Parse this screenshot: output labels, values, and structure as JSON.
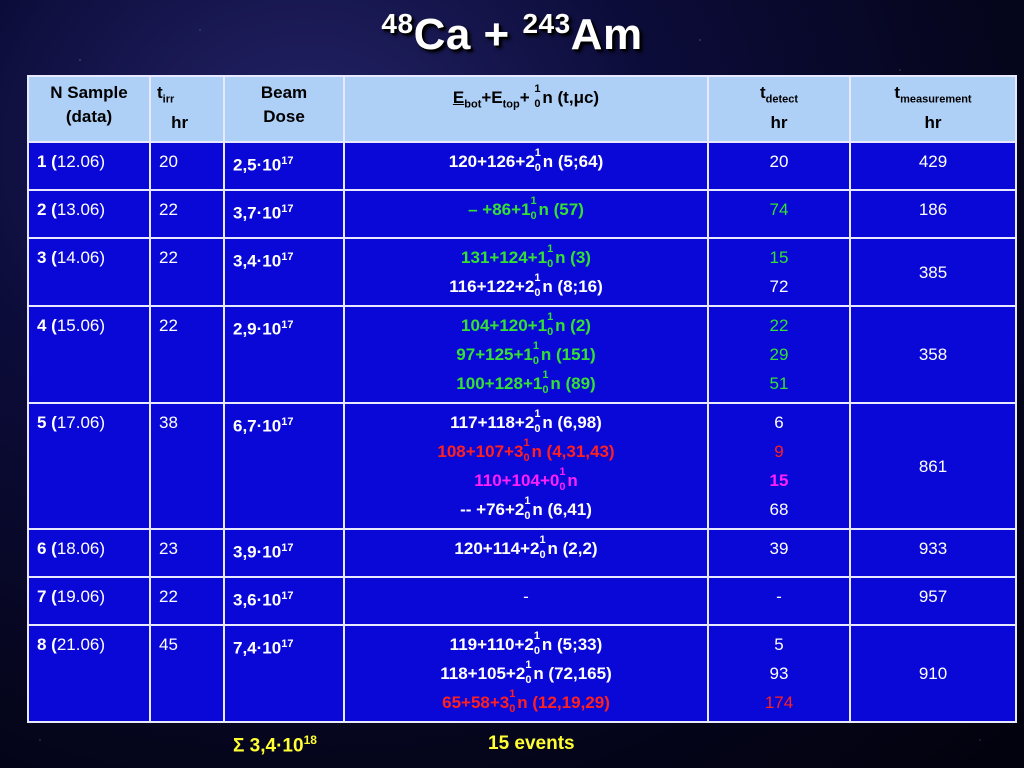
{
  "title": {
    "mass1": "48",
    "el1": "Ca + ",
    "mass2": "243",
    "el2": "Am"
  },
  "headers": {
    "n_sample": "N Sample",
    "n_sample_sub": "(data)",
    "tirr": "t",
    "tirr_sub": "irr",
    "tirr_unit": "hr",
    "beam": "Beam",
    "beam2": "Dose",
    "e_bot": "E",
    "e_bot_sub": "bot",
    "e_top": "+E",
    "e_top_sub": "top",
    "e_plus": "+ ",
    "nuc_top": "1",
    "nuc_bot": "0",
    "e_rest": "n (t,",
    "mu": "μ",
    "e_close": "c)",
    "tdet": "t",
    "tdet_sub": "detect",
    "tdet_unit": "hr",
    "tmeas": "t",
    "tmeas_sub": "measurement",
    "tmeas_unit": "hr"
  },
  "rows": [
    {
      "n": "1 (",
      "date": "12.06)",
      "tirr": "20",
      "dose_a": "2,5",
      "dose_b": "·10",
      "dose_exp": "17",
      "events": [
        {
          "pre": "120+126+2",
          "post": "n (5;64)",
          "cls": "w"
        }
      ],
      "tdet": [
        {
          "v": "20",
          "cls": ""
        }
      ],
      "tmeas": "429"
    },
    {
      "n": "2 (",
      "date": "13.06)",
      "tirr": "22",
      "dose_a": "3,7",
      "dose_b": "·10",
      "dose_exp": "17",
      "events": [
        {
          "pre": "– +86+1",
          "post": "n (57)",
          "cls": "g"
        }
      ],
      "tdet": [
        {
          "v": "74",
          "cls": "gn"
        }
      ],
      "tmeas": "186"
    },
    {
      "n": "3 (",
      "date": "14.06)",
      "tirr": "22",
      "dose_a": "3,4",
      "dose_b": "·10",
      "dose_exp": "17",
      "events": [
        {
          "pre": "131+124+1",
          "post": "n (3)",
          "cls": "g"
        },
        {
          "pre": "116+122+2",
          "post": "n (8;16)",
          "cls": "w"
        }
      ],
      "tdet": [
        {
          "v": "15",
          "cls": "gn"
        },
        {
          "v": "72",
          "cls": ""
        }
      ],
      "tmeas": "385"
    },
    {
      "n": "4 (",
      "date": "15.06)",
      "tirr": "22",
      "dose_a": "2,9",
      "dose_b": "·10",
      "dose_exp": "17",
      "events": [
        {
          "pre": "104+120+1",
          "post": "n (2)",
          "cls": "g"
        },
        {
          "pre": "97+125+1",
          "post": "n (151)",
          "cls": "g"
        },
        {
          "pre": "100+128+1",
          "post": "n (89)",
          "cls": "g"
        }
      ],
      "tdet": [
        {
          "v": "22",
          "cls": "gn"
        },
        {
          "v": "29",
          "cls": "gn"
        },
        {
          "v": "51",
          "cls": "gn"
        }
      ],
      "tmeas": "358"
    },
    {
      "n": "5 (",
      "date": "17.06)",
      "tirr": "38",
      "dose_a": "6,7",
      "dose_b": "·10",
      "dose_exp": "17",
      "events": [
        {
          "pre": "117+118+2",
          "post": "n (6,98)",
          "cls": "w"
        },
        {
          "pre": "108+107+3",
          "post": "n (4,31,43)",
          "cls": "r"
        },
        {
          "pre": "110+104+0",
          "post": "n",
          "cls": "m"
        },
        {
          "pre": "-- +76+2",
          "post": "n (6,41)",
          "cls": "w"
        }
      ],
      "tdet": [
        {
          "v": "6",
          "cls": ""
        },
        {
          "v": "9",
          "cls": "rn"
        },
        {
          "v": "15",
          "cls": "m"
        },
        {
          "v": "68",
          "cls": ""
        }
      ],
      "tmeas": "861"
    },
    {
      "n": "6 (",
      "date": "18.06)",
      "tirr": "23",
      "dose_a": "3,9",
      "dose_b": "·10",
      "dose_exp": "17",
      "events": [
        {
          "pre": "120+114+2",
          "post": "n (2,2)",
          "cls": "w"
        }
      ],
      "tdet": [
        {
          "v": "39",
          "cls": ""
        }
      ],
      "tmeas": "933"
    },
    {
      "n": "7 (",
      "date": "19.06)",
      "tirr": "22",
      "dose_a": "3,6",
      "dose_b": "·10",
      "dose_exp": "17",
      "events": [
        {
          "pre": "-",
          "post": "",
          "cls": "plain"
        }
      ],
      "tdet": [
        {
          "v": "-",
          "cls": ""
        }
      ],
      "tmeas": "957"
    },
    {
      "n": "8 (",
      "date": "21.06)",
      "tirr": "45",
      "dose_a": "7,4",
      "dose_b": "·10",
      "dose_exp": "17",
      "events": [
        {
          "pre": "119+110+2",
          "post": "n (5;33)",
          "cls": "w"
        },
        {
          "pre": "118+105+2",
          "post": "n (72,165)",
          "cls": "w"
        },
        {
          "pre": "65+58+3",
          "post": "n (12,19,29)",
          "cls": "r"
        }
      ],
      "tdet": [
        {
          "v": "5",
          "cls": ""
        },
        {
          "v": "93",
          "cls": ""
        },
        {
          "v": "174",
          "cls": "rn"
        }
      ],
      "tmeas": "910"
    }
  ],
  "footer": {
    "sigma": "Σ 3,4",
    "dot10": "·10",
    "exp": "18",
    "events": "15 events"
  }
}
